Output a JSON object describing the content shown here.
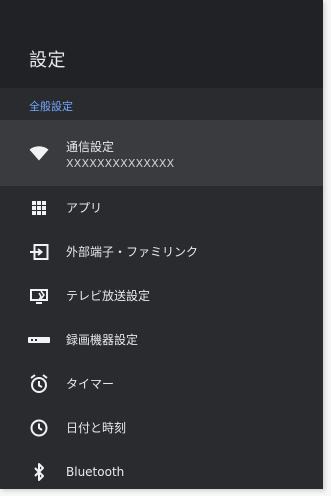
{
  "header": {
    "title": "設定"
  },
  "section": {
    "label": "全般設定"
  },
  "items": [
    {
      "label": "通信設定",
      "sublabel": "XXXXXXXXXXXXXX",
      "icon": "wifi-icon"
    },
    {
      "label": "アプリ",
      "icon": "grid-icon"
    },
    {
      "label": "外部端子・ファミリンク",
      "icon": "input-icon"
    },
    {
      "label": "テレビ放送設定",
      "icon": "tv-icon"
    },
    {
      "label": "録画機器設定",
      "icon": "recorder-icon"
    },
    {
      "label": "タイマー",
      "icon": "alarm-icon"
    },
    {
      "label": "日付と時刻",
      "icon": "clock-icon"
    },
    {
      "label": "Bluetooth",
      "icon": "bluetooth-icon"
    }
  ],
  "colors": {
    "panel_bg": "#2a2b2e",
    "header_bg": "#212225",
    "selected_bg": "#3a3b3f",
    "accent": "#72a8ff",
    "text": "#e8e9ec"
  }
}
